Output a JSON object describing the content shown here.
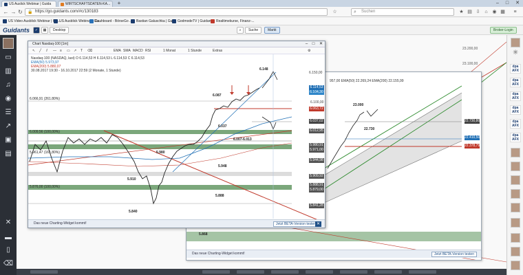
{
  "browser": {
    "tabs": [
      {
        "label": "US Auslick Webinar | Guida"
      },
      {
        "label": "WIRTSCHAFTSDATEN-KA..."
      }
    ],
    "url": "https://go.guidants.com/#c/130183",
    "search_placeholder": "Suchen"
  },
  "bookmarks": [
    {
      "label": "US Video Ausblick Webinar | Gu..."
    },
    {
      "label": "US Ausblick Webinar | Gu..."
    },
    {
      "label": "Dashboard - BörseGo ..."
    },
    {
      "label": "Bastian Galuschka | Gui..."
    },
    {
      "label": "GodmodeTV | Guidants"
    },
    {
      "label": "Realtimekurse, Finanz-..."
    }
  ],
  "app": {
    "logo": "Guidants",
    "desktop_label": "Desktop",
    "suche_label": "Suche",
    "markt_label": "Markt",
    "login_label": "Broker-Login"
  },
  "right_sidebar": [
    {
      "label": "dpa AFX"
    },
    {
      "label": "dpa AFX"
    },
    {
      "label": "dpa AFX"
    },
    {
      "label": "dpa AFX"
    },
    {
      "label": "dpa AFX"
    },
    {
      "label": "dpa AFX"
    }
  ],
  "chart1": {
    "window_title": "Chart Nasdaq-100 [1m]",
    "toolbar": [
      "EMA",
      "SMA",
      "MACD",
      "RSI",
      "1 Monat",
      "1 Stunde",
      "Extras"
    ],
    "info_line1": "Nasdaq-100 (NASDAQ, last)  O 6.114,53  H 6.114,53  L 6.114,53  C 6.114,53",
    "info_ema50": "EMA(50)  5.973,97",
    "info_ema200": "EMA(200)  5.880,07",
    "info_range": "30.08.2017 19:30 - 16.10.2017 22:59  (2 Monate, 1 Stunde)",
    "price_ticks": [
      "6.150,00",
      "6.100,00",
      "6.050,00",
      "6.000,00",
      "5.950,00",
      "5.900,00",
      "5.850,00"
    ],
    "price_boxes": [
      {
        "label": "6.114,53",
        "color": "#1f6fb5"
      },
      {
        "label": "6.104,30",
        "color": "#2e86c9"
      },
      {
        "label": "6.063,72",
        "color": "#c0392b"
      },
      {
        "label": "6.037,02",
        "color": "#444444"
      },
      {
        "label": "6.012,95",
        "color": "#555555"
      },
      {
        "label": "5.980,91",
        "color": "#555555"
      },
      {
        "label": "5.971,00",
        "color": "#555555"
      },
      {
        "label": "5.944,98",
        "color": "#555555"
      },
      {
        "label": "5.909,92",
        "color": "#555555"
      },
      {
        "label": "5.888,91",
        "color": "#555555"
      },
      {
        "label": "5.879,00",
        "color": "#555555"
      },
      {
        "label": "5.841,28",
        "color": "#555555"
      }
    ],
    "left_levels": [
      "6.066,91 (261.80%)",
      "6.009,56 (100,00%)",
      "5.961,47 (161,80%)",
      "5.876,00 (100,00%)"
    ],
    "annotations": [
      "6.148",
      "6.087",
      "6.037",
      "6.007-6.013",
      "5.980",
      "5.948",
      "5.910",
      "5.888",
      "5.840"
    ],
    "notice": "Das neue Charting-Widget kommt!",
    "notice_button": "Jetzt BETA-Version testen"
  },
  "chart2": {
    "info": "957,00   EMA(50)  22.269,24   EMA(200)  22.155,99",
    "annotations": [
      "23.000",
      "22.730"
    ],
    "price_ticks": [
      "23.200,00",
      "23.100,00",
      "23.000,00",
      "22.900,00",
      "22.800,00",
      "22.700,00",
      "22.600,00",
      "22.500,00",
      "22.400,00",
      "22.300,00",
      "22.200,00",
      "22.100,00",
      "22.000,00",
      "21.900,00",
      "21.800,00",
      "21.700,00",
      "21.600,00",
      "21.500,00",
      "21.400,00"
    ],
    "price_boxes": [
      {
        "label": "22.730,80",
        "color": "#444444"
      },
      {
        "label": "22.410,50",
        "color": "#1f6fb5"
      },
      {
        "label": "22.378,79",
        "color": "#c0392b"
      }
    ],
    "left_annotation": "5.868",
    "notice": "Das neue Charting-Widget kommt!",
    "notice_button": "Jetzt BETA-Version testen"
  }
}
